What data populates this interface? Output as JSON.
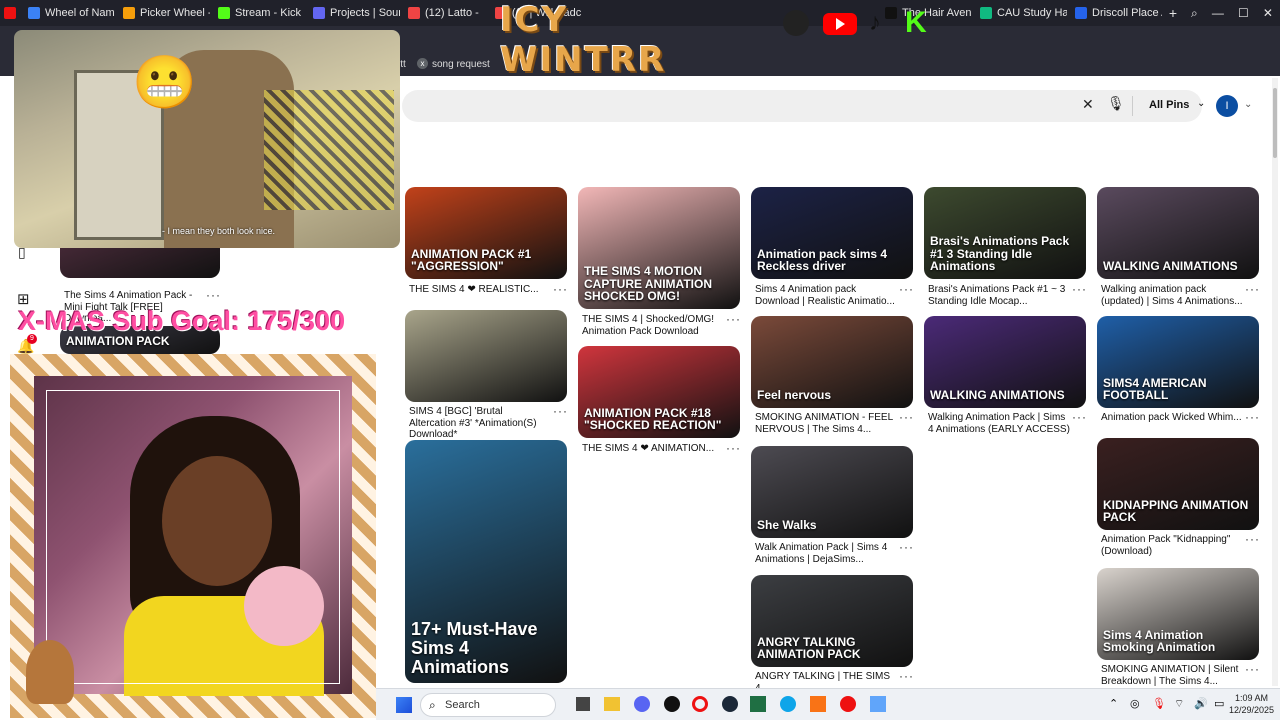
{
  "browser": {
    "tabs": [
      {
        "label": "Wheel of Name",
        "color": "#3b82f6"
      },
      {
        "label": "Picker Wheel - S",
        "color": "#f59e0b"
      },
      {
        "label": "Stream - Kick D",
        "color": "#53fc18"
      },
      {
        "label": "Projects | Sound",
        "color": "#6366f1"
      },
      {
        "label": "(12) Latto - ",
        "color": "#ef4444"
      },
      {
        "label": "(((· | Will Badc",
        "color": "#ef4444"
      }
    ],
    "tabs_right": [
      {
        "label": "The Hair Avenu",
        "color": "#111111"
      },
      {
        "label": "CAU Study Hall",
        "color": "#10b981"
      },
      {
        "label": "Driscoll Place A",
        "color": "#2563eb"
      }
    ],
    "bookmarks": [
      {
        "label": "itt"
      },
      {
        "label": "song request"
      }
    ],
    "time": "1:09 AM",
    "date": "12/29/2025"
  },
  "overlay": {
    "streamer_name": "ICY WINTRR",
    "sub_goal": "X-MAS Sub Goal: 175/300",
    "subtitle": "- I mean they both look nice.",
    "emoji": "😬"
  },
  "pinterest": {
    "search_placeholder": "",
    "filter_label": "All Pins",
    "avatar_letter": "I",
    "pins": [
      {
        "caption": "The Sims 4 Animation Pack - Mini Fight Talk [FREE] Downloa...",
        "image_text": "",
        "bg": "#4a2b3a"
      },
      {
        "caption": "",
        "image_text": "ANIMATION PACK",
        "bg": "#3b3a46"
      },
      {
        "caption": "THE SIMS 4 ❤ REALISTIC...",
        "image_text": "ANIMATION PACK #1 \"AGGRESSION\"",
        "bg": "#c2421a"
      },
      {
        "caption": "SIMS 4 [BGC] 'Brutal Altercation #3' *Animation(S) Download*",
        "image_text": "",
        "bg": "#a9a58b"
      },
      {
        "caption": "",
        "image_text": "17+ Must-Have Sims 4 Animations",
        "bg": "#2a6f9c"
      },
      {
        "caption": "THE SIMS 4 | Shocked/OMG! Animation Pack Download",
        "image_text": "THE SIMS 4 MOTION CAPTURE ANIMATION SHOCKED OMG!",
        "bg": "#f2b7b7"
      },
      {
        "caption": "THE SIMS 4 ❤ ANIMATION...",
        "image_text": "ANIMATION PACK #18 \"SHOCKED REACTION\"",
        "bg": "#d0353d"
      },
      {
        "caption": "Sims 4 Animation pack Download | Realistic Animatio...",
        "image_text": "Animation pack sims 4 Reckless driver",
        "bg": "#1c2246"
      },
      {
        "caption": "SMOKING ANIMATION - FEEL NERVOUS | The Sims 4...",
        "image_text": "Feel nervous",
        "bg": "#7b4a3a"
      },
      {
        "caption": "Walk Animation Pack | Sims 4 Animations | DejaSims...",
        "image_text": "She Walks",
        "bg": "#4d4b52"
      },
      {
        "caption": "ANGRY TALKING | THE SIMS 4...",
        "image_text": "ANGRY TALKING ANIMATION PACK",
        "bg": "#3c3e42"
      },
      {
        "caption": "Brasi's Animations Pack #1 ~ 3 Standing Idle Mocap...",
        "image_text": "Brasi's Animations Pack #1 3 Standing Idle Animations",
        "bg": "#3d4a2f"
      },
      {
        "caption": "Walking Animation Pack | Sims 4 Animations (EARLY ACCESS)",
        "image_text": "WALKING ANIMATIONS",
        "bg": "#4b2a78"
      },
      {
        "caption": "Walking animation pack (updated) | Sims 4 Animations...",
        "image_text": "WALKING ANIMATIONS",
        "bg": "#5a4a5e"
      },
      {
        "caption": "Animation pack Wicked Whim...",
        "image_text": "SIMS4 AMERICAN FOOTBALL",
        "bg": "#1f5fa8"
      },
      {
        "caption": "Animation Pack \"Kidnapping\" (Download)",
        "image_text": "KIDNAPPING ANIMATION PACK",
        "bg": "#3a2020"
      },
      {
        "caption": "SMOKING ANIMATION | Silent Breakdown | The Sims 4...",
        "image_text": "Sims 4 Animation Smoking Animation",
        "bg": "#d9d3cd"
      }
    ]
  },
  "taskbar": {
    "search_label": "Search"
  },
  "colors": {
    "pinterest_red": "#e60023",
    "overlay_gold": "#e7a64a",
    "overlay_pink": "#ff4fa3"
  }
}
